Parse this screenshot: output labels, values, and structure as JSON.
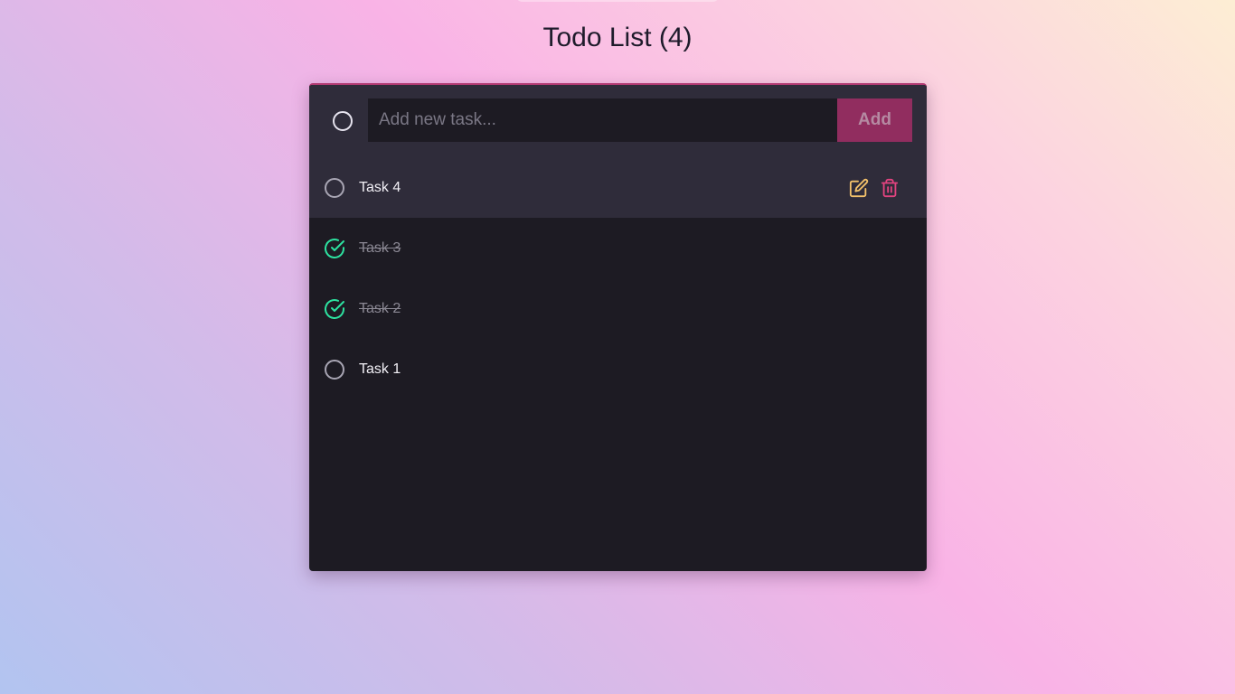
{
  "header": {
    "title": "Todo List (4)"
  },
  "add_task": {
    "placeholder": "Add new task...",
    "value": "",
    "button_label": "Add"
  },
  "tasks": [
    {
      "label": "Task 4",
      "completed": false
    },
    {
      "label": "Task 3",
      "completed": true
    },
    {
      "label": "Task 2",
      "completed": true
    },
    {
      "label": "Task 1",
      "completed": false
    }
  ],
  "icons": {
    "unchecked": "circle-icon",
    "checked": "check-circle-icon",
    "edit": "edit-icon",
    "delete": "trash-icon"
  },
  "colors": {
    "accent": "#912d5f",
    "edit": "#f4c26b",
    "delete": "#e2437f",
    "checked": "#2de2a0"
  }
}
